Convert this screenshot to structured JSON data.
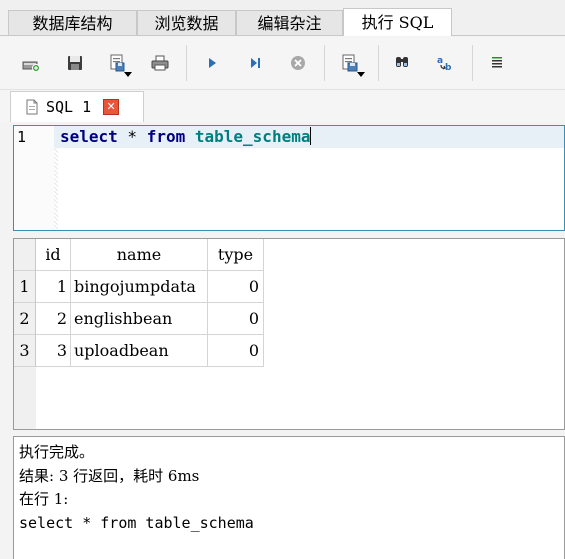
{
  "top_tabs": [
    "数据库结构",
    "浏览数据",
    "编辑杂注",
    "执行 SQL"
  ],
  "active_tab_index": 3,
  "toolbar": {
    "buttons": [
      "open-tab-icon",
      "save-icon",
      "save-results-icon",
      "print-icon",
      "execute-all-icon",
      "execute-line-icon",
      "stop-icon",
      "save-sql-icon",
      "find-icon",
      "find-replace-icon",
      "comment-icon"
    ]
  },
  "editor_tab": {
    "label": "SQL 1"
  },
  "editor": {
    "line_number": "1",
    "tokens": {
      "kw1": "select",
      "op": " * ",
      "kw2": "from",
      "sp": " ",
      "table": "table_schema"
    }
  },
  "result": {
    "columns": [
      "id",
      "name",
      "type"
    ],
    "rows": [
      {
        "row_no": "1",
        "cells": [
          "1",
          "bingojumpdata",
          "0"
        ]
      },
      {
        "row_no": "2",
        "cells": [
          "2",
          "englishbean",
          "0"
        ]
      },
      {
        "row_no": "3",
        "cells": [
          "3",
          "uploadbean",
          "0"
        ]
      }
    ]
  },
  "messages": {
    "line1": "执行完成。",
    "line2": "结果: 3 行返回，耗时 6ms",
    "line3": "在行 1:",
    "line4": "select * from table_schema"
  },
  "colors": {
    "keyword": "#00007f",
    "table_name": "#007f7f",
    "editor_border": "#3a8fb7",
    "close_button": "#e8553b"
  }
}
